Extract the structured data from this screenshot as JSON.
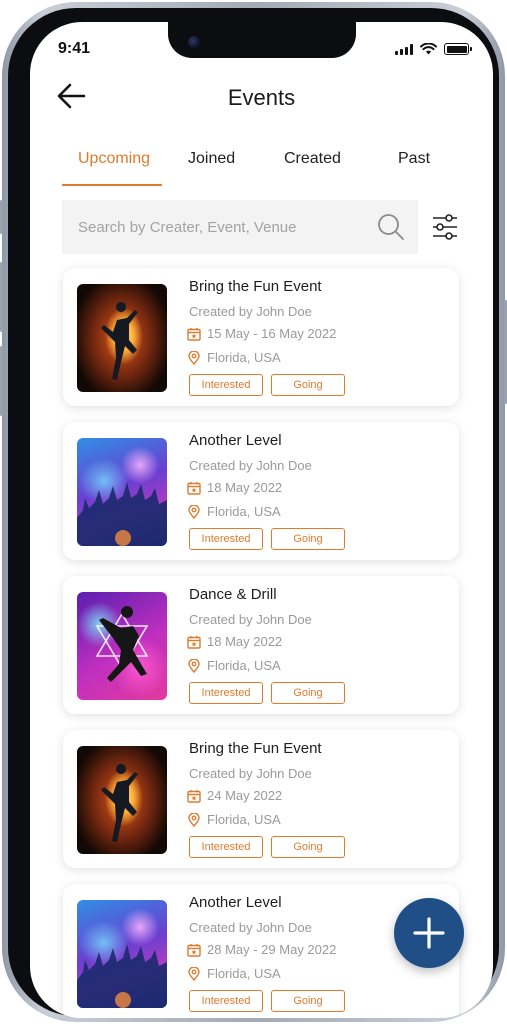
{
  "status_bar": {
    "time": "9:41"
  },
  "header": {
    "title": "Events"
  },
  "tabs": [
    {
      "label": "Upcoming",
      "active": true
    },
    {
      "label": "Joined",
      "active": false
    },
    {
      "label": "Created",
      "active": false
    },
    {
      "label": "Past",
      "active": false
    }
  ],
  "search": {
    "placeholder": "Search by Creater, Event, Venue",
    "value": ""
  },
  "events": [
    {
      "title": "Bring the Fun Event",
      "creator": "Created by John Doe",
      "date": "15 May - 16 May 2022",
      "location": "Florida, USA",
      "interested_label": "Interested",
      "going_label": "Going",
      "image": "fire-dancer-poster"
    },
    {
      "title": "Another Level",
      "creator": "Created by John Doe",
      "date": "18 May 2022",
      "location": "Florida, USA",
      "interested_label": "Interested",
      "going_label": "Going",
      "image": "concert-crowd-poster"
    },
    {
      "title": "Dance & Drill",
      "creator": "Created by John Doe",
      "date": "18 May 2022",
      "location": "Florida, USA",
      "interested_label": "Interested",
      "going_label": "Going",
      "image": "star-dancer-poster"
    },
    {
      "title": "Bring the Fun Event",
      "creator": "Created by John Doe",
      "date": "24 May 2022",
      "location": "Florida, USA",
      "interested_label": "Interested",
      "going_label": "Going",
      "image": "fire-dancer-poster"
    },
    {
      "title": "Another Level",
      "creator": "Created by John Doe",
      "date": "28 May - 29 May 2022",
      "location": "Florida, USA",
      "interested_label": "Interested",
      "going_label": "Going",
      "image": "concert-crowd-poster"
    }
  ],
  "fab": {
    "icon": "plus-icon"
  },
  "colors": {
    "accent": "#e07b2e",
    "fab": "#1f4f86",
    "search_bg": "#f3f3f3",
    "muted_text": "#9a9a9a"
  }
}
